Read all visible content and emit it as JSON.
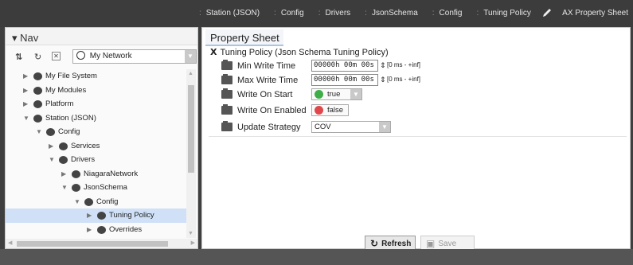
{
  "breadcrumb": [
    "Station (JSON)",
    "Config",
    "Drivers",
    "JsonSchema",
    "Config",
    "Tuning Policy"
  ],
  "view_switch": {
    "label": "AX Property Sheet",
    "icon": "pen-icon"
  },
  "nav": {
    "title": "Nav",
    "network_select": "My Network",
    "tree": [
      {
        "label": "My File System",
        "depth": 0,
        "expanded": false,
        "icon": "drive-icon"
      },
      {
        "label": "My Modules",
        "depth": 0,
        "expanded": false,
        "icon": "modules-icon"
      },
      {
        "label": "Platform",
        "depth": 0,
        "expanded": false,
        "icon": "platform-icon"
      },
      {
        "label": "Station (JSON)",
        "depth": 0,
        "expanded": true,
        "icon": "station-icon"
      },
      {
        "label": "Config",
        "depth": 1,
        "expanded": true,
        "icon": "config-icon"
      },
      {
        "label": "Services",
        "depth": 2,
        "expanded": false,
        "icon": "services-icon"
      },
      {
        "label": "Drivers",
        "depth": 2,
        "expanded": true,
        "icon": "drivers-icon"
      },
      {
        "label": "NiagaraNetwork",
        "depth": 3,
        "expanded": false,
        "icon": "network-icon"
      },
      {
        "label": "JsonSchema",
        "depth": 3,
        "expanded": true,
        "icon": "braces-icon"
      },
      {
        "label": "Config",
        "depth": 4,
        "expanded": true,
        "icon": "config-icon"
      },
      {
        "label": "Tuning Policy",
        "depth": 5,
        "expanded": false,
        "icon": "tuning-icon",
        "selected": true
      },
      {
        "label": "Overrides",
        "depth": 5,
        "expanded": false,
        "icon": "overrides-icon"
      }
    ]
  },
  "property_sheet": {
    "tab": "Property Sheet",
    "title": "Tuning Policy  (Json Schema Tuning Policy)",
    "min_write_time": {
      "label": "Min Write Time",
      "value": "00000h 00m 00s",
      "range": "[0 ms - +inf]"
    },
    "max_write_time": {
      "label": "Max Write Time",
      "value": "00000h 00m 00s",
      "range": "[0 ms - +inf]"
    },
    "write_on_start": {
      "label": "Write On Start",
      "value": "true",
      "color": "#3fae49"
    },
    "write_on_enabled": {
      "label": "Write On Enabled",
      "value": "false",
      "color": "#e0474c"
    },
    "update_strategy": {
      "label": "Update Strategy",
      "value": "COV"
    }
  },
  "buttons": {
    "refresh": "Refresh",
    "save": "Save"
  }
}
